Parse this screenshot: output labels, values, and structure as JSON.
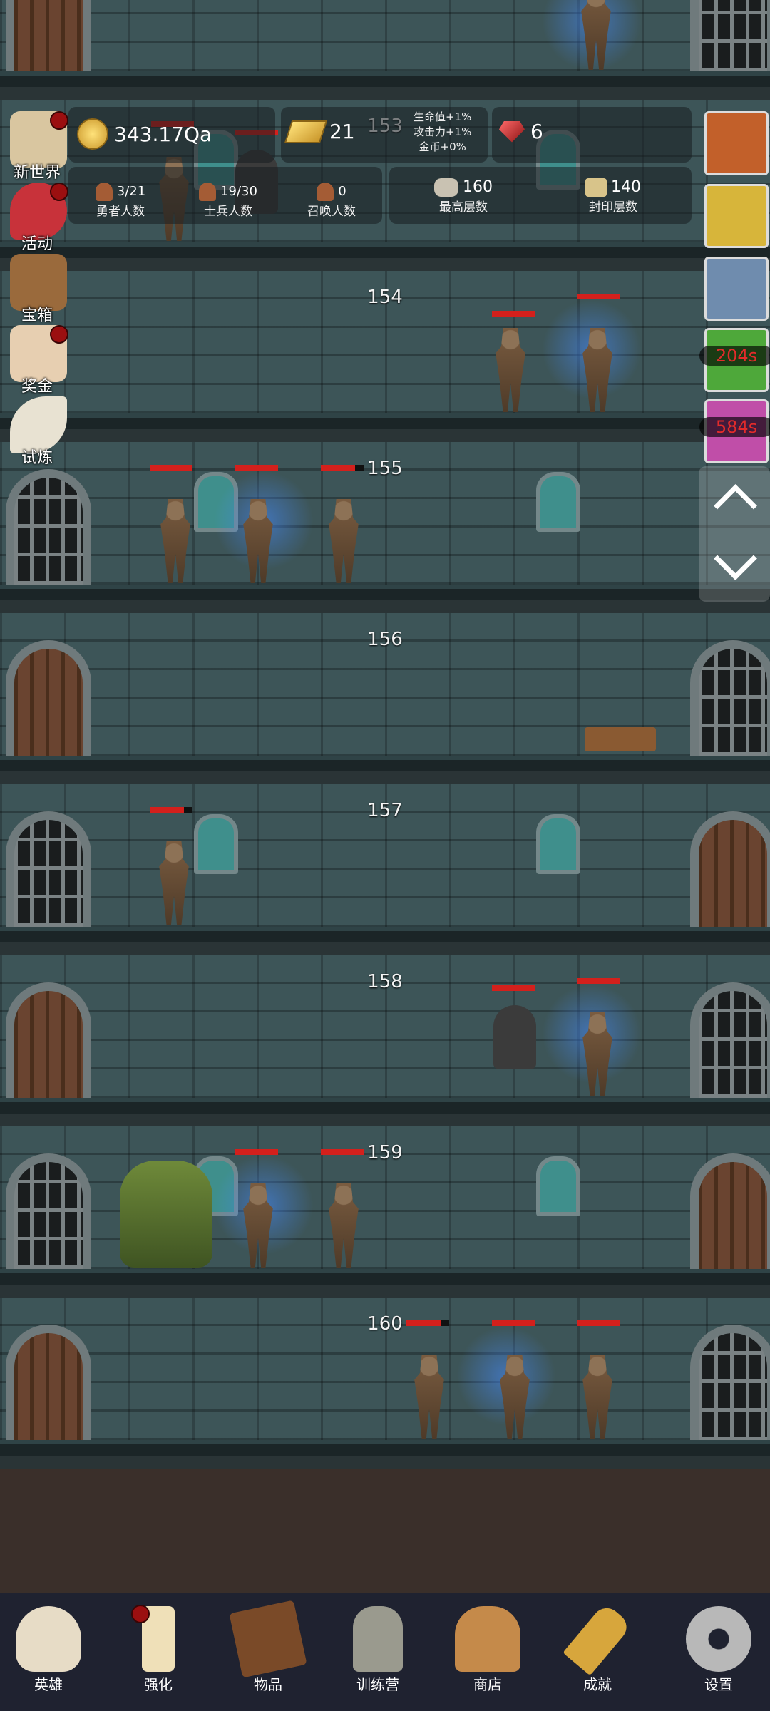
{
  "floors": [
    {
      "number": "153"
    },
    {
      "number": "154"
    },
    {
      "number": "155"
    },
    {
      "number": "156"
    },
    {
      "number": "157"
    },
    {
      "number": "158"
    },
    {
      "number": "159"
    },
    {
      "number": "160"
    }
  ],
  "hud": {
    "coins": "343.17Qa",
    "gold_bars": "21",
    "gems": "6",
    "bonus_hp": "生命值+1%",
    "bonus_attack": "攻击力+1%",
    "bonus_gold": "金币+0%",
    "heroes_count": "3/21",
    "heroes_label": "勇者人数",
    "soldiers_count": "19/30",
    "soldiers_label": "士兵人数",
    "summons_count": "0",
    "summons_label": "召唤人数",
    "max_floor": "160",
    "max_floor_label": "最高层数",
    "sealed_floor": "140",
    "sealed_floor_label": "封印层数"
  },
  "side_menu": [
    {
      "label": "新世界",
      "icon": "map-icon",
      "badge": true
    },
    {
      "label": "活动",
      "icon": "heart-icon",
      "badge": true
    },
    {
      "label": "宝箱",
      "icon": "chest-icon",
      "badge": false
    },
    {
      "label": "奖金",
      "icon": "envelope-icon",
      "badge": true
    },
    {
      "label": "试炼",
      "icon": "feather-icon",
      "badge": false
    }
  ],
  "buffs": [
    {
      "icon": "pumpkin-icon",
      "timer": ""
    },
    {
      "icon": "candle-icon",
      "timer": ""
    },
    {
      "icon": "scroll-icon",
      "timer": ""
    },
    {
      "icon": "green-potion-icon",
      "timer": "204s"
    },
    {
      "icon": "pink-potion-icon",
      "timer": "584s"
    }
  ],
  "bottom_nav": [
    {
      "label": "英雄",
      "icon": "skull-icon",
      "badge": false
    },
    {
      "label": "强化",
      "icon": "candle-icon",
      "badge": true
    },
    {
      "label": "物品",
      "icon": "book-icon",
      "badge": false
    },
    {
      "label": "训练营",
      "icon": "lantern-icon",
      "badge": false
    },
    {
      "label": "商店",
      "icon": "mug-icon",
      "badge": false
    },
    {
      "label": "成就",
      "icon": "key-icon",
      "badge": false
    },
    {
      "label": "设置",
      "icon": "gear-icon",
      "badge": false
    }
  ],
  "colors": {
    "hp_bar": "#d3201c",
    "badge": "#9b0f10",
    "timer_text": "#e32b2b",
    "wall": "#3d5558"
  }
}
